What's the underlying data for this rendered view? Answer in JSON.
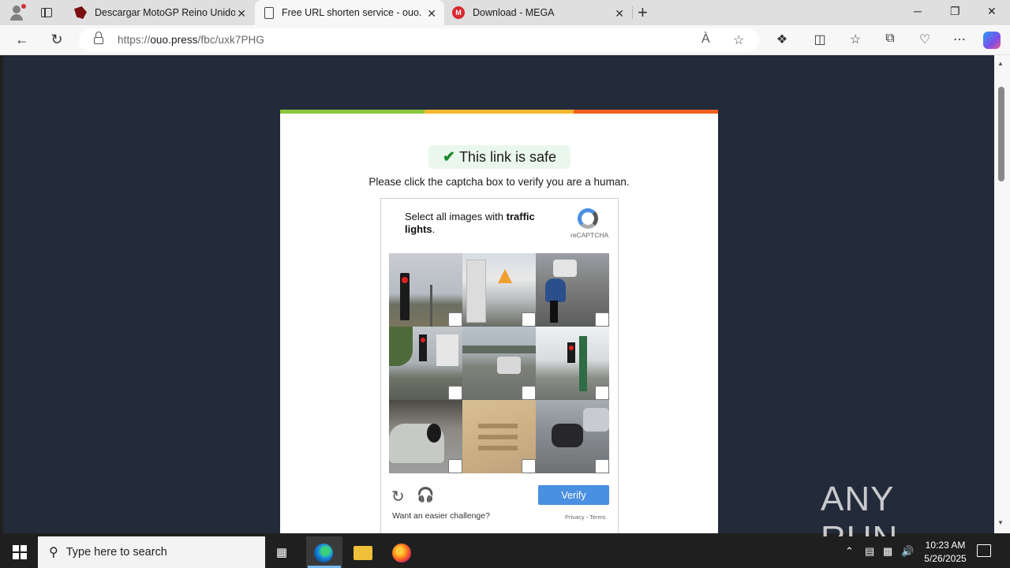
{
  "browser": {
    "tabs": [
      {
        "title": "Descargar MotoGP Reino Unido",
        "close": "✕"
      },
      {
        "title": "Free URL shorten service - ouo.press",
        "close": "✕"
      },
      {
        "title": "Download - MEGA",
        "close": "✕"
      }
    ],
    "new_tab": "+",
    "url_prefix": "https://",
    "url_domain": "ouo.press",
    "url_path": "/fbc/uxk7PHG",
    "window_controls": {
      "minimize": "─",
      "restore": "❐",
      "close": "✕"
    }
  },
  "page": {
    "safe_badge": "This link is safe",
    "instruction": "Please click the captcha box to verify you are a human.",
    "captcha": {
      "prompt_prefix": "Select all images with ",
      "prompt_bold": "traffic lights",
      "prompt_suffix": ".",
      "brand": "reCAPTCHA",
      "verify_label": "Verify",
      "easier_link": "Want an easier challenge?",
      "privacy": "Privacy",
      "terms": "Terms",
      "tiles": [
        {
          "subject": "traffic light on pole"
        },
        {
          "subject": "buildings and warning sign"
        },
        {
          "subject": "motorcyclist on road"
        },
        {
          "subject": "traffic light at intersection"
        },
        {
          "subject": "highway with cars"
        },
        {
          "subject": "street with traffic light"
        },
        {
          "subject": "parked car and motorcycle"
        },
        {
          "subject": "stairs"
        },
        {
          "subject": "motorcycles parked"
        }
      ]
    },
    "watermark": "ANY RUN"
  },
  "taskbar": {
    "search_placeholder": "Type here to search",
    "time": "10:23 AM",
    "date": "5/26/2025"
  },
  "colors": {
    "page_bg": "#232b3a",
    "bar_green": "#8cc63f",
    "bar_yellow": "#f5b82e",
    "bar_orange": "#ef6121",
    "verify_blue": "#4a90e2",
    "safe_green": "#1e8a32"
  }
}
